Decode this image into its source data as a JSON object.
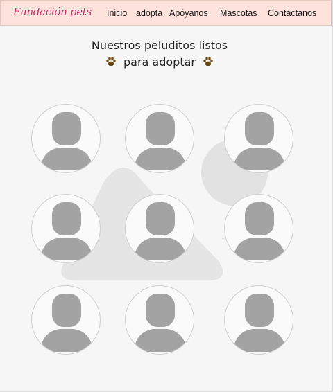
{
  "nav": {
    "brand": "Fundación pets",
    "links": [
      "Inicio",
      "adopta",
      "Apóyanos",
      "Mascotas",
      "Contáctanos"
    ]
  },
  "heading": {
    "line1": "Nuestros peluditos listos",
    "line2": "para adoptar"
  },
  "icons": {
    "paw": "paw-icon",
    "avatar": "user-placeholder-icon"
  },
  "colors": {
    "navbar": "#fde3dc",
    "brand": "#c8326c",
    "paw": "#6b4a0f",
    "avatar": "#a3a3a3"
  },
  "gallery": {
    "items": 9
  }
}
